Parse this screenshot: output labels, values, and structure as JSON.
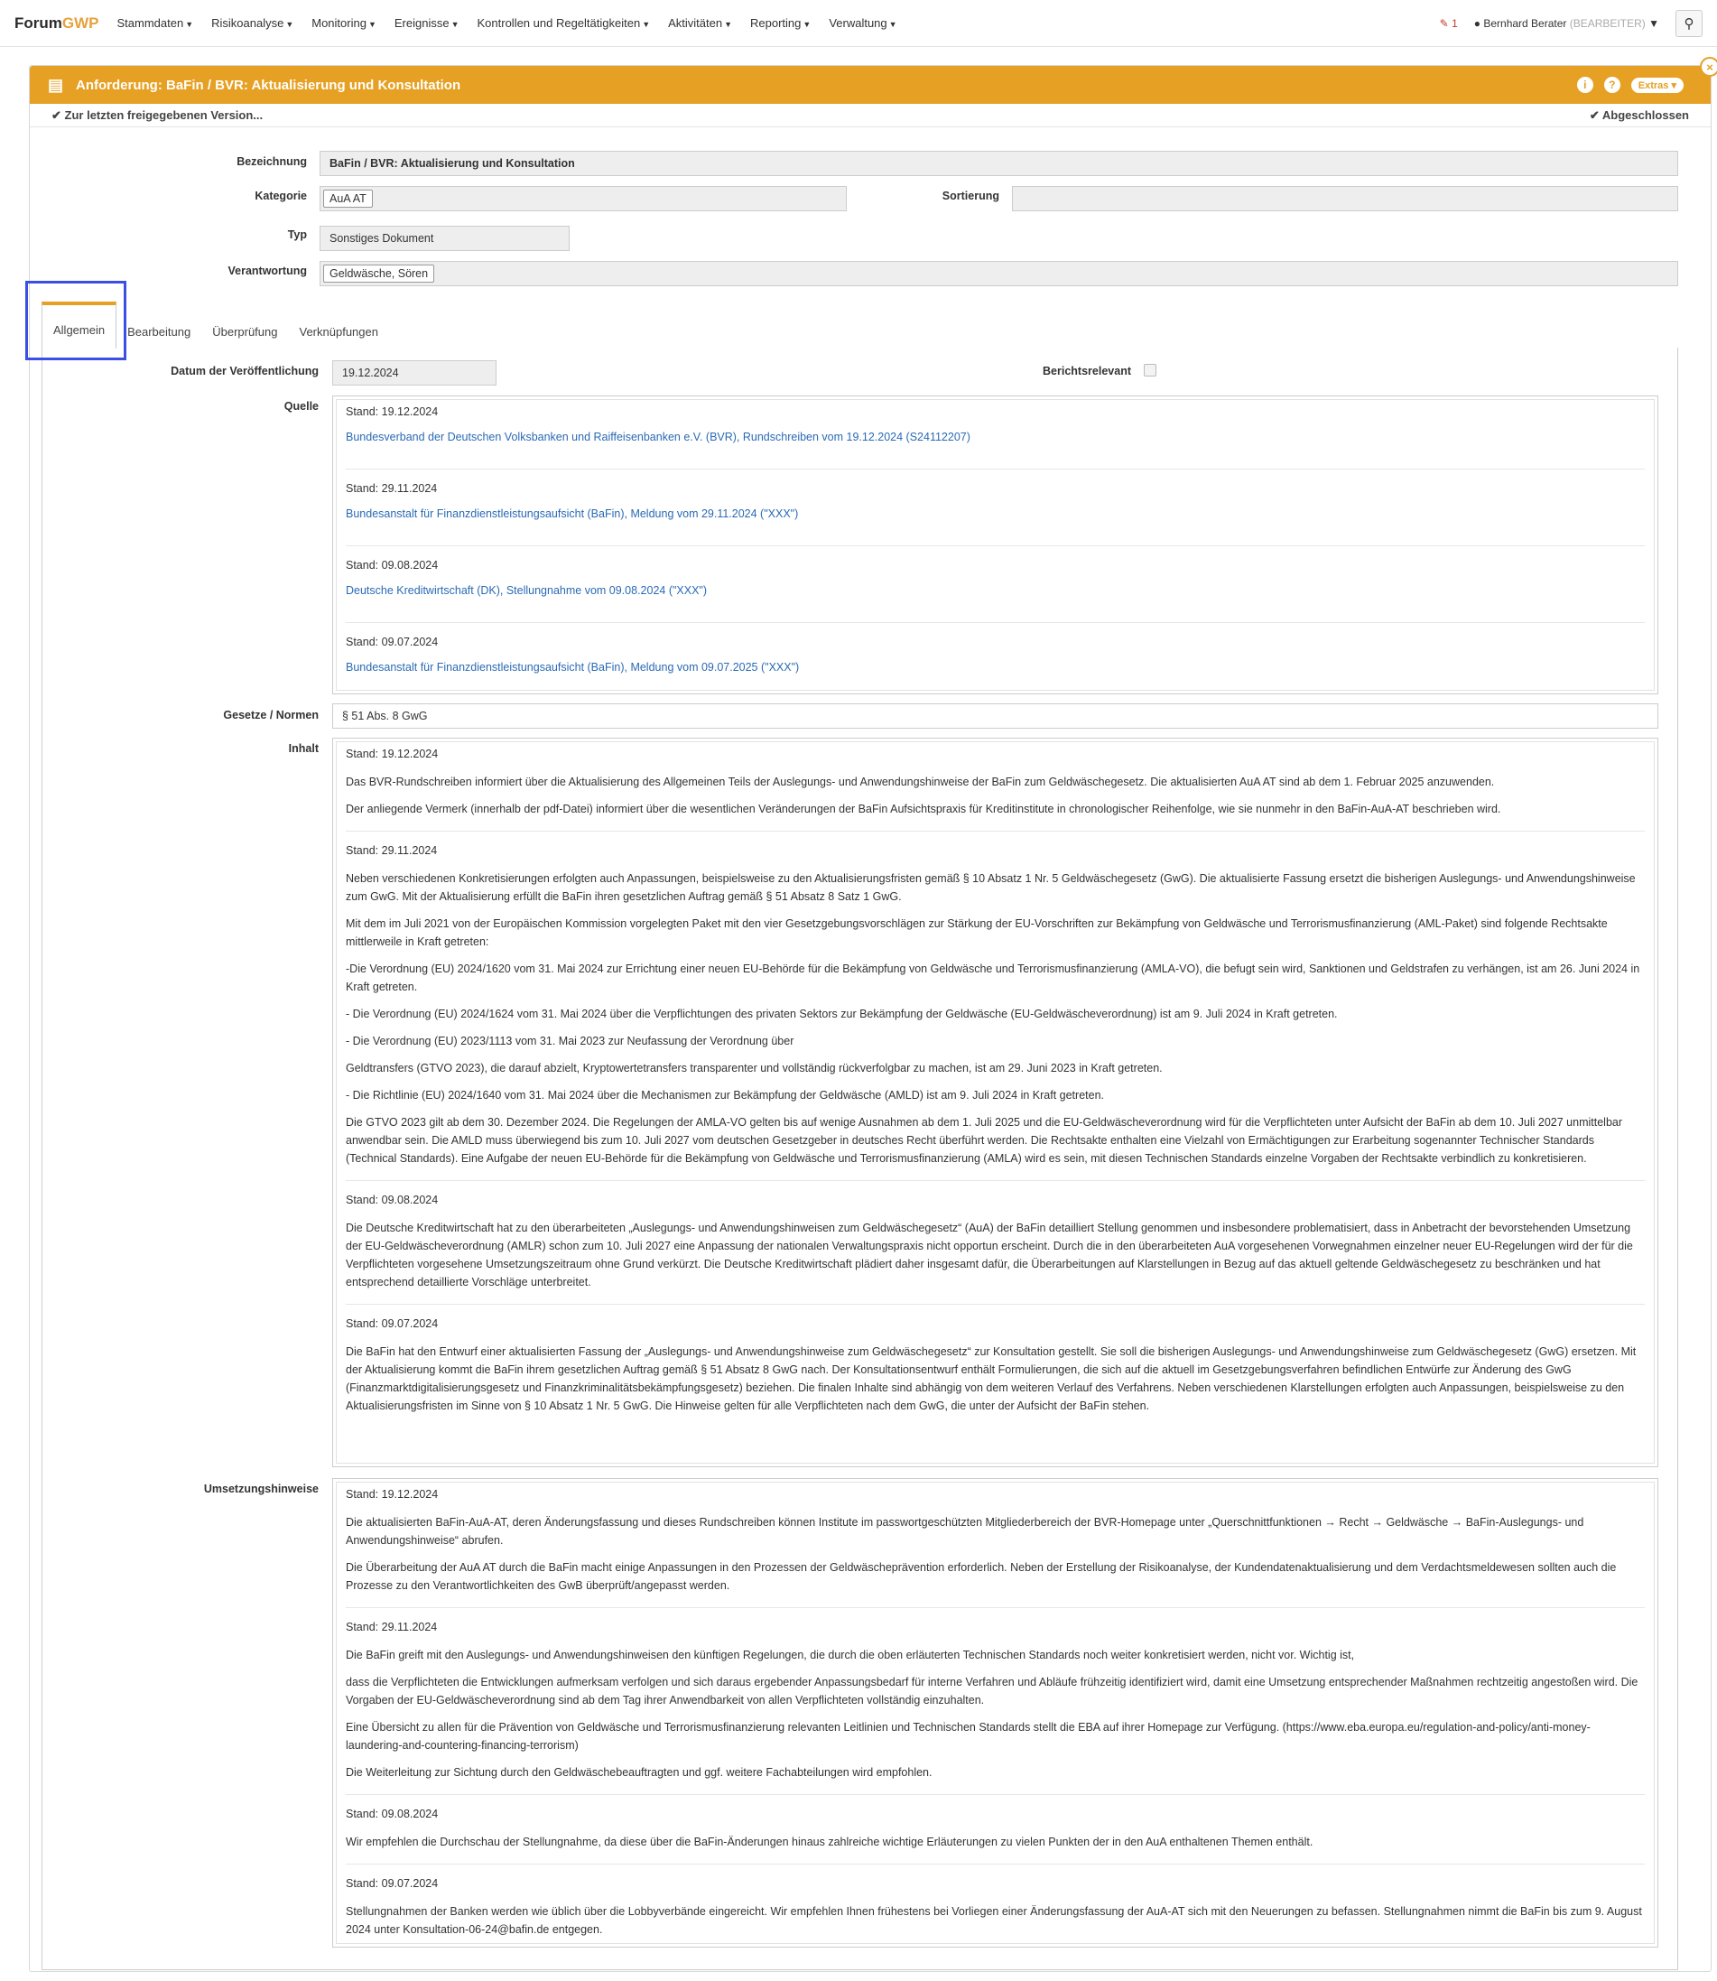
{
  "nav": {
    "brand_a": "Forum",
    "brand_b": "GWP",
    "items": [
      "Stammdaten",
      "Risikoanalyse",
      "Monitoring",
      "Ereignisse",
      "Kontrollen und Regeltätigkeiten",
      "Aktivitäten",
      "Reporting",
      "Verwaltung"
    ],
    "alert_count": "1",
    "user_name": "Bernhard Berater",
    "user_role": "(BEARBEITER)"
  },
  "header": {
    "title": "Anforderung: BaFin / BVR: Aktualisierung und Konsultation",
    "extras": "Extras",
    "info": "i",
    "help": "?"
  },
  "subbar": {
    "back_link": "Zur letzten freigegebenen Version...",
    "status": "Abgeschlossen"
  },
  "form": {
    "bezeichnung_label": "Bezeichnung",
    "bezeichnung": "BaFin / BVR: Aktualisierung und Konsultation",
    "kategorie_label": "Kategorie",
    "kategorie": "AuA AT",
    "sortierung_label": "Sortierung",
    "sortierung": "",
    "typ_label": "Typ",
    "typ": "Sonstiges Dokument",
    "verantwortung_label": "Verantwortung",
    "verantwortung": "Geldwäsche, Sören"
  },
  "tabs": [
    "Allgemein",
    "Bearbeitung",
    "Überprüfung",
    "Verknüpfungen"
  ],
  "allgemein": {
    "datum_label": "Datum der Veröffentlichung",
    "datum": "19.12.2024",
    "berichtsrelevant_label": "Berichtsrelevant",
    "quelle_label": "Quelle",
    "quelle": [
      {
        "stand": "Stand: 19.12.2024",
        "link": "Bundesverband der Deutschen Volksbanken und Raiffeisenbanken e.V. (BVR), Rundschreiben vom 19.12.2024 (S24112207)"
      },
      {
        "stand": "Stand: 29.11.2024",
        "link": "Bundesanstalt für Finanzdienstleistungsaufsicht (BaFin), Meldung vom 29.11.2024 (\"XXX\")"
      },
      {
        "stand": "Stand: 09.08.2024",
        "link": "Deutsche Kreditwirtschaft (DK), Stellungnahme vom 09.08.2024 (\"XXX\")"
      },
      {
        "stand": "Stand: 09.07.2024",
        "link": "Bundesanstalt für Finanzdienstleistungsaufsicht (BaFin), Meldung vom 09.07.2025 (\"XXX\")"
      }
    ],
    "gesetze_label": "Gesetze / Normen",
    "gesetze": "§ 51 Abs. 8 GwG",
    "inhalt_label": "Inhalt",
    "inhalt": [
      {
        "stand": "Stand: 19.12.2024",
        "paras": [
          "Das BVR-Rundschreiben informiert über die Aktualisierung des Allgemeinen Teils der Auslegungs- und Anwendungshinweise der BaFin zum Geldwäschegesetz. Die aktualisierten AuA AT sind ab dem 1. Februar 2025 anzuwenden.",
          "Der anliegende Vermerk (innerhalb der pdf-Datei) informiert über die wesentlichen Veränderungen der BaFin Aufsichtspraxis für Kreditinstitute in chronologischer Reihenfolge, wie sie nunmehr in den BaFin-AuA-AT beschrieben wird."
        ]
      },
      {
        "stand": "Stand: 29.11.2024",
        "paras": [
          "Neben verschiedenen Konkretisierungen erfolgten auch Anpassungen, beispielsweise zu den Aktualisierungsfristen gemäß § 10 Absatz 1 Nr. 5 Geldwäschegesetz (GwG). Die aktualisierte Fassung ersetzt die bisherigen Auslegungs- und Anwendungshinweise zum GwG. Mit der Aktualisierung erfüllt die BaFin ihren gesetzlichen Auftrag gemäß § 51 Absatz 8 Satz 1 GwG.",
          "Mit dem im Juli 2021 von der Europäischen Kommission vorgelegten Paket mit den vier Gesetzgebungsvorschlägen zur Stärkung der EU-Vorschriften zur Bekämpfung von Geldwäsche und Terrorismusfinanzierung (AML-Paket) sind folgende Rechtsakte mittlerweile in Kraft getreten:",
          "-Die Verordnung (EU) 2024/1620 vom 31. Mai 2024 zur Errichtung einer neuen EU-Behörde für die Bekämpfung von Geldwäsche und Terrorismusfinanzierung (AMLA-VO), die befugt sein wird, Sanktionen und Geldstrafen zu verhängen, ist am 26. Juni 2024 in Kraft getreten.",
          "- Die Verordnung (EU) 2024/1624 vom 31. Mai 2024 über die Verpflichtungen des privaten Sektors zur Bekämpfung der Geldwäsche (EU-Geldwäscheverordnung) ist am 9. Juli 2024 in Kraft getreten.",
          "- Die Verordnung (EU) 2023/1113 vom 31. Mai 2023 zur Neufassung der Verordnung über",
          "Geldtransfers (GTVO 2023), die darauf abzielt, Kryptowertetransfers transparenter und vollständig rückverfolgbar zu machen, ist am 29. Juni 2023 in Kraft getreten.",
          "- Die Richtlinie (EU) 2024/1640 vom 31. Mai 2024 über die Mechanismen zur Bekämpfung der Geldwäsche (AMLD) ist am 9. Juli 2024 in Kraft getreten.",
          "Die GTVO 2023 gilt ab dem 30. Dezember 2024. Die Regelungen der AMLA-VO gelten bis auf wenige Ausnahmen ab dem 1. Juli 2025 und die EU-Geldwäscheverordnung wird für die Verpflichteten unter Aufsicht der BaFin ab dem 10. Juli 2027 unmittelbar anwendbar sein. Die AMLD muss überwiegend bis zum 10. Juli 2027 vom deutschen Gesetzgeber in deutsches Recht überführt werden. Die Rechtsakte enthalten eine Vielzahl von Ermächtigungen zur Erarbeitung sogenannter Technischer Standards (Technical Standards). Eine Aufgabe der neuen EU-Behörde für die Bekämpfung von Geldwäsche und Terrorismusfinanzierung (AMLA) wird es sein, mit diesen Technischen Standards einzelne Vorgaben der Rechtsakte verbindlich zu konkretisieren."
        ]
      },
      {
        "stand": "Stand: 09.08.2024",
        "paras": [
          "Die Deutsche Kreditwirtschaft hat zu den überarbeiteten „Auslegungs- und Anwendungshinweisen zum Geldwäschegesetz“ (AuA) der BaFin detailliert Stellung genommen und insbesondere problematisiert, dass in Anbetracht der bevorstehenden Umsetzung der EU-Geldwäscheverordnung (AMLR) schon zum 10. Juli 2027 eine Anpassung der nationalen Verwaltungspraxis nicht opportun erscheint. Durch die in den überarbeiteten AuA vorgesehenen Vorwegnahmen einzelner neuer EU-Regelungen wird der für die Verpflichteten vorgesehene Umsetzungszeitraum ohne Grund verkürzt. Die Deutsche Kreditwirtschaft plädiert daher insgesamt dafür, die Überarbeitungen auf Klarstellungen in Bezug auf das aktuell geltende Geldwäschegesetz zu beschränken und hat entsprechend detaillierte Vorschläge unterbreitet."
        ]
      },
      {
        "stand": "Stand: 09.07.2024",
        "paras": [
          "Die BaFin hat den Entwurf einer aktualisierten Fassung der „Auslegungs- und Anwendungshinweise zum Geldwäschegesetz“ zur Konsultation gestellt. Sie soll die bisherigen Auslegungs- und Anwendungshinweise zum Geldwäschegesetz (GwG) ersetzen. Mit der Aktualisierung kommt die BaFin ihrem gesetzlichen Auftrag gemäß § 51 Absatz 8 GwG nach. Der Konsultationsentwurf enthält Formulierungen, die sich auf die aktuell im Gesetzgebungsverfahren befindlichen Entwürfe zur Änderung des GwG (Finanzmarktdigitalisierungsgesetz und Finanzkriminalitätsbekämpfungsgesetz) beziehen. Die finalen Inhalte sind abhängig von dem weiteren Verlauf des Verfahrens. Neben verschiedenen Klarstellungen erfolgten auch Anpassungen, beispielsweise zu den Aktualisierungsfristen im Sinne von § 10 Absatz 1 Nr. 5 GwG. Die Hinweise gelten für alle Verpflichteten nach dem GwG, die unter der Aufsicht der BaFin stehen."
        ]
      }
    ],
    "umsetzung_label": "Umsetzungshinweise",
    "umsetzung": [
      {
        "stand": "Stand: 19.12.2024",
        "paras": [
          "Die aktualisierten BaFin-AuA-AT, deren Änderungsfassung und dieses Rundschreiben können Institute im passwortgeschützten Mitgliederbereich der BVR-Homepage unter „Querschnittfunktionen → Recht → Geldwäsche → BaFin-Auslegungs- und Anwendungshinweise“ abrufen.",
          "Die Überarbeitung der AuA AT durch die BaFin macht einige Anpassungen in den Prozessen der Geldwäscheprävention erforderlich. Neben der Erstellung der Risikoanalyse, der Kundendatenaktualisierung und dem Verdachtsmeldewesen sollten auch die Prozesse zu den Verantwortlichkeiten des GwB überprüft/angepasst werden."
        ]
      },
      {
        "stand": "Stand: 29.11.2024",
        "paras": [
          "Die BaFin greift mit den Auslegungs- und Anwendungshinweisen den künftigen Regelungen, die durch die oben erläuterten Technischen Standards noch weiter konkretisiert werden, nicht vor. Wichtig ist,",
          "dass die Verpflichteten die Entwicklungen aufmerksam verfolgen und sich daraus ergebender Anpassungsbedarf für interne Verfahren und Abläufe frühzeitig identifiziert wird, damit eine Umsetzung entsprechender Maßnahmen rechtzeitig angestoßen wird. Die Vorgaben der EU-Geldwäscheverordnung sind ab dem Tag ihrer Anwendbarkeit von allen Verpflichteten vollständig einzuhalten.",
          "Eine Übersicht zu allen für die Prävention von Geldwäsche und Terrorismusfinanzierung relevanten Leitlinien und Technischen Standards stellt die EBA auf ihrer Homepage zur Verfügung. (https://www.eba.europa.eu/regulation-and-policy/anti-money-laundering-and-countering-financing-terrorism)",
          "Die Weiterleitung zur Sichtung durch den Geldwäschebeauftragten und ggf. weitere Fachabteilungen wird empfohlen."
        ]
      },
      {
        "stand": "Stand: 09.08.2024",
        "paras": [
          "Wir empfehlen die Durchschau der Stellungnahme, da diese über die BaFin-Änderungen hinaus zahlreiche wichtige Erläuterungen zu vielen Punkten der in den AuA enthaltenen Themen enthält."
        ]
      },
      {
        "stand": "Stand: 09.07.2024",
        "paras": [
          "Stellungnahmen der Banken werden wie üblich über die Lobbyverbände eingereicht. Wir empfehlen Ihnen frühestens bei Vorliegen einer Änderungsfassung der AuA-AT sich mit den Neuerungen zu befassen. Stellungnahmen nimmt die BaFin bis zum 9. August 2024 unter Konsultation-06-24@bafin.de entgegen."
        ]
      }
    ]
  }
}
